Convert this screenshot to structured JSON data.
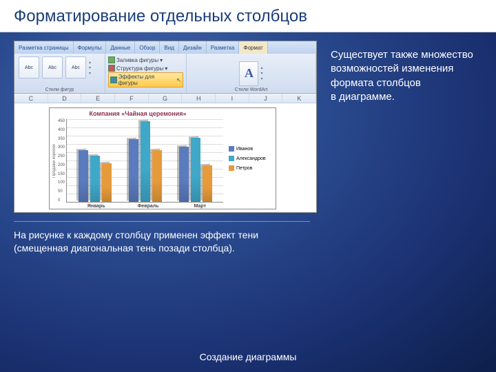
{
  "slide": {
    "title": "Форматирование отдельных столбцов",
    "description": "Существует также множество возможностей изменения формата столбцов в диаграмме.",
    "caption": "На рисунке к каждому столбцу применен эффект тени (смещенная диагональная тень позади столбца).",
    "footer": "Создание диаграммы"
  },
  "ribbon": {
    "tabs": [
      "Разметка страницы",
      "Формулы",
      "Данные",
      "Обзор",
      "Вид",
      "Дизайн",
      "Разметка",
      "Формат"
    ],
    "active_tab": "Формат",
    "shape_btn": "Abc",
    "styles_group_label": "Стили фигур",
    "wordart_group_label": "Стили WordArt",
    "fill_label": "Заливка фигуры",
    "outline_label": "Структура фигуры",
    "effects_label": "Эффекты для фигуры",
    "big_a": "A"
  },
  "sheet": {
    "cols": [
      "C",
      "D",
      "E",
      "F",
      "G",
      "H",
      "I",
      "J",
      "K"
    ]
  },
  "chart_data": {
    "type": "bar",
    "title": "Компания «Чайная церемония»",
    "ylabel": "Продажи коробок",
    "ylim": [
      0,
      450
    ],
    "yticks": [
      "450",
      "400",
      "350",
      "300",
      "250",
      "200",
      "150",
      "100",
      "50",
      "0"
    ],
    "categories": [
      "Январь",
      "Февраль",
      "Март"
    ],
    "series": [
      {
        "name": "Иванов",
        "color": "#5b7bbf",
        "values": [
          280,
          340,
          300
        ]
      },
      {
        "name": "Александров",
        "color": "#3fa8c9",
        "values": [
          250,
          440,
          350
        ]
      },
      {
        "name": "Петров",
        "color": "#e69a3a",
        "values": [
          210,
          280,
          200
        ]
      }
    ]
  }
}
